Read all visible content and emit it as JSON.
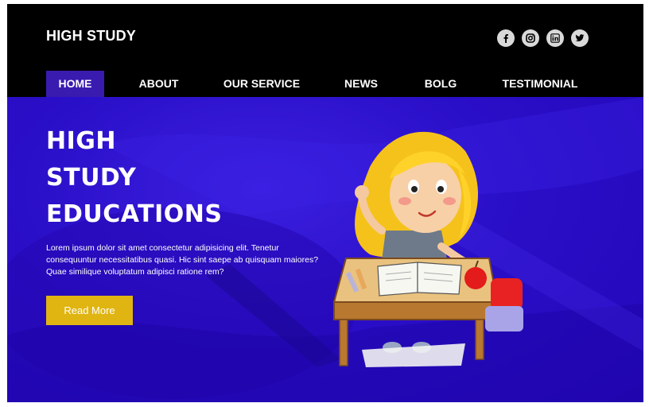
{
  "header": {
    "brand": "HIGH STUDY",
    "social_icons": [
      "facebook-icon",
      "instagram-icon",
      "linkedin-icon",
      "twitter-icon"
    ]
  },
  "nav": {
    "items": [
      {
        "label": "HOME",
        "active": true
      },
      {
        "label": "ABOUT",
        "active": false
      },
      {
        "label": "OUR SERVICE",
        "active": false
      },
      {
        "label": "NEWS",
        "active": false
      },
      {
        "label": "BOLG",
        "active": false
      },
      {
        "label": "TESTIMONIAL",
        "active": false
      }
    ]
  },
  "hero": {
    "title_lines": [
      "HIGH",
      "STUDY",
      "EDUCATIONS"
    ],
    "description": "Lorem ipsum dolor sit amet consectetur adipisicing elit. Tenetur consequuntur necessitatibus quasi. Hic sint saepe ab quisquam maiores? Quae similique voluptatum adipisci ratione rem?",
    "button_label": "Read More"
  },
  "colors": {
    "header_bg": "#000000",
    "hero_bg": "#2a0fc8",
    "nav_active": "#3a1bb0",
    "button": "#e0b511"
  }
}
